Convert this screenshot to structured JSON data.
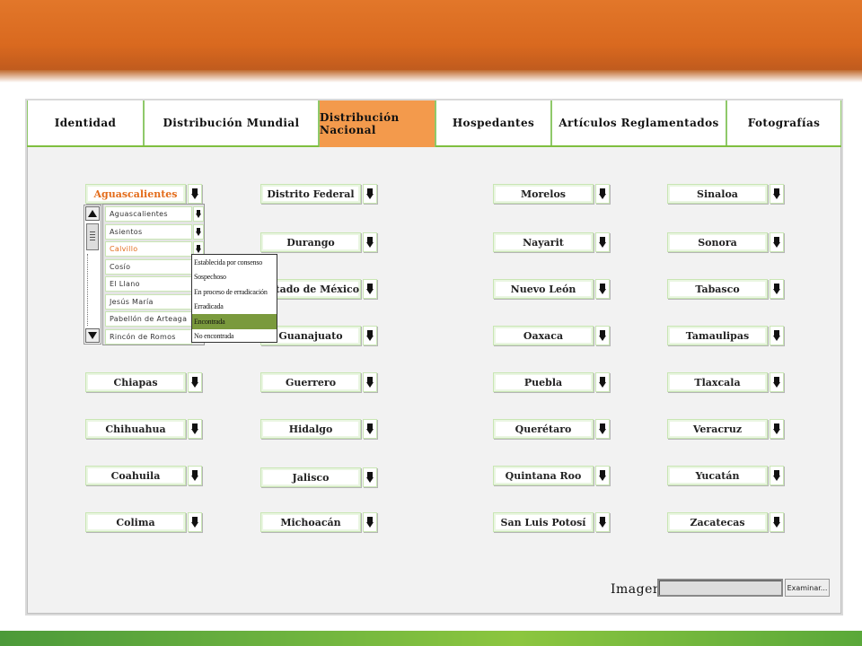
{
  "tabs": [
    {
      "label": "Identidad",
      "active": false
    },
    {
      "label": "Distribución Mundial",
      "active": false
    },
    {
      "label": "Distribución Nacional",
      "active": true
    },
    {
      "label": "Hospedantes",
      "active": false
    },
    {
      "label": "Artículos Reglamentados",
      "active": false
    },
    {
      "label": "Fotografías",
      "active": false
    }
  ],
  "states": {
    "col1": [
      "Aguascalientes",
      "Chiapas",
      "Chihuahua",
      "Coahuila",
      "Colima"
    ],
    "col2": [
      "Distrito Federal",
      "Durango",
      "Estado de México",
      "Guanajuato",
      "Guerrero",
      "Hidalgo",
      "Jalisco",
      "Michoacán"
    ],
    "col3": [
      "Morelos",
      "Nayarit",
      "Nuevo León",
      "Oaxaca",
      "Puebla",
      "Querétaro",
      "Quintana Roo",
      "San Luis Potosí"
    ],
    "col4": [
      "Sinaloa",
      "Sonora",
      "Tabasco",
      "Tamaulipas",
      "Tlaxcala",
      "Veracruz",
      "Yucatán",
      "Zacatecas"
    ]
  },
  "municipios": [
    "Aguascalientes",
    "Asientos",
    "Calvillo",
    "Cosío",
    "El Llano",
    "Jesús María",
    "Pabellón de Arteaga",
    "Rincón de Romos"
  ],
  "status_options": [
    "Establecida por consenso",
    "Sospechoso",
    "En proceso de erradicación",
    "Erradicada",
    "Encontrada",
    "No encontrada"
  ],
  "selected_status": "Encontrada",
  "image": {
    "label": "Imagen",
    "browse_label": "Examinar...",
    "value": ""
  },
  "colors": {
    "accent_orange": "#e36c1b",
    "tab_active": "#f39a4c",
    "green": "#7fbf3f",
    "selected_option": "#7a9a3d"
  }
}
